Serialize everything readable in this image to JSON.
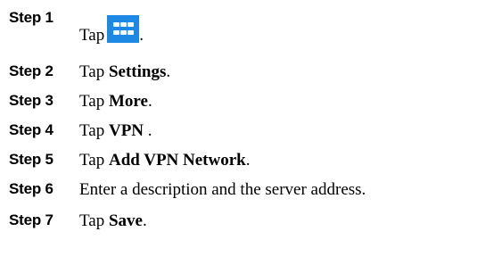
{
  "steps": [
    {
      "label": "Step 1",
      "prefix": "Tap",
      "bold": "",
      "suffix": ".",
      "icon": "apps-grid-icon"
    },
    {
      "label": "Step 2",
      "prefix": "Tap ",
      "bold": "Settings",
      "suffix": "."
    },
    {
      "label": "Step 3",
      "prefix": "Tap ",
      "bold": "More",
      "suffix": "."
    },
    {
      "label": "Step 4",
      "prefix": "Tap ",
      "bold": "VPN",
      "suffix": " ."
    },
    {
      "label": "Step 5",
      "prefix": "Tap ",
      "bold": "Add VPN Network",
      "suffix": "."
    },
    {
      "label": "Step 6",
      "prefix": "Enter a description and the server address.",
      "bold": "",
      "suffix": ""
    },
    {
      "label": "Step 7",
      "prefix": "Tap ",
      "bold": "Save",
      "suffix": "."
    }
  ],
  "colors": {
    "icon_background": "#1e88e5",
    "icon_foreground": "#ffffff"
  }
}
